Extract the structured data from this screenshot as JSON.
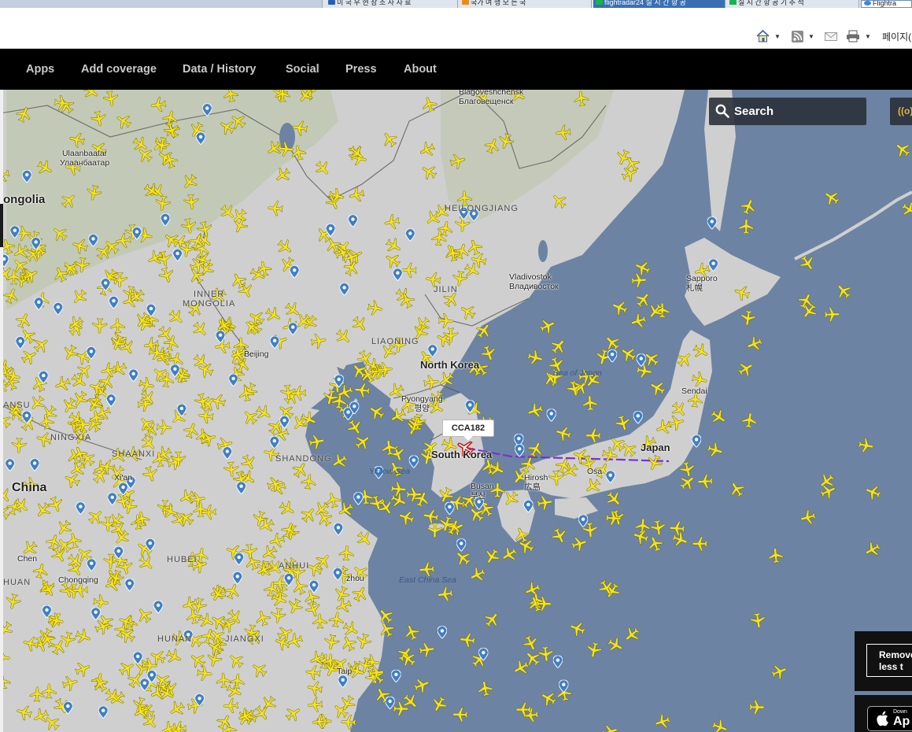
{
  "browser": {
    "tabs": [
      {
        "label": "",
        "active": false
      },
      {
        "label": "미 국 우 현 장 조 사 자 료",
        "active": false
      },
      {
        "label": "국가 여 행 모 든 국",
        "active": false
      },
      {
        "label": "flightradar24 실 시 간 항 공",
        "active": false
      },
      {
        "label": "실 시 간 항 공 기 추 적",
        "active": false
      },
      {
        "label": "Flightra",
        "active": true
      }
    ],
    "command_bar": {
      "home_icon": "home-icon",
      "feeds_icon": "rss-icon",
      "mail_icon": "mail-icon",
      "print_icon": "printer-icon",
      "page_label": "페이지("
    }
  },
  "nav": {
    "items": [
      "Apps",
      "Add coverage",
      "Data / History",
      "Social",
      "Press",
      "About"
    ]
  },
  "map": {
    "search_placeholder": "Search",
    "radar_label": "((o))",
    "selected_flight": "CCA182",
    "labels": {
      "mongolia": "ongolia",
      "china": "China",
      "north_korea": "North Korea",
      "south_korea": "South Korea",
      "japan": "Japan",
      "inner_mongolia": "INNER\nMONGOLIA",
      "heilongjiang": "HEILONGJIANG",
      "jilin": "JILIN",
      "liaoning": "LIAONING",
      "ningxia": "NINGXIA",
      "shaanxi": "SHAANXI",
      "shandong": "SHANDONG",
      "hubei": "HUBEI",
      "anhui": "ANHUI",
      "jiangxi": "JIANGXI",
      "hunan": "HUNAN",
      "gansu": "ANSU",
      "sichuan": "HUAN",
      "ulaanbaatar": "Ulaanbaatar\nУлаанбаатар",
      "blagoveshchensk": "Blagoveshchensk\nБлаговещенск",
      "vladivostok": "Vladivostok\nВладивосток",
      "sapporo": "Sapporo\n札幌",
      "sendai": "Sendai",
      "beijing": "Beijing",
      "pyongyang": "Pyongyang\n평양",
      "busan": "Busan\n부산",
      "hiroshima": "Hirosh\n広島",
      "osaka": "Osa",
      "xian": "Xi'an",
      "chongqing": "Chongqing",
      "chengdu": "Chen",
      "hangzhou": "zhou",
      "taipei": "Taip",
      "yellow_sea": "Yellow Sea",
      "sea_of_japan": "Sea of Japan",
      "east_china_sea": "East China Sea"
    },
    "promo_label": "Remove\nless t",
    "appstore_small": "Down",
    "appstore_big": "Ap",
    "colors": {
      "sea": "#6c83a3",
      "land": "#cfcfcf",
      "aircraft": "#f5e31c",
      "marker": "#3f7fc7",
      "route": "#7a2fd6"
    }
  }
}
